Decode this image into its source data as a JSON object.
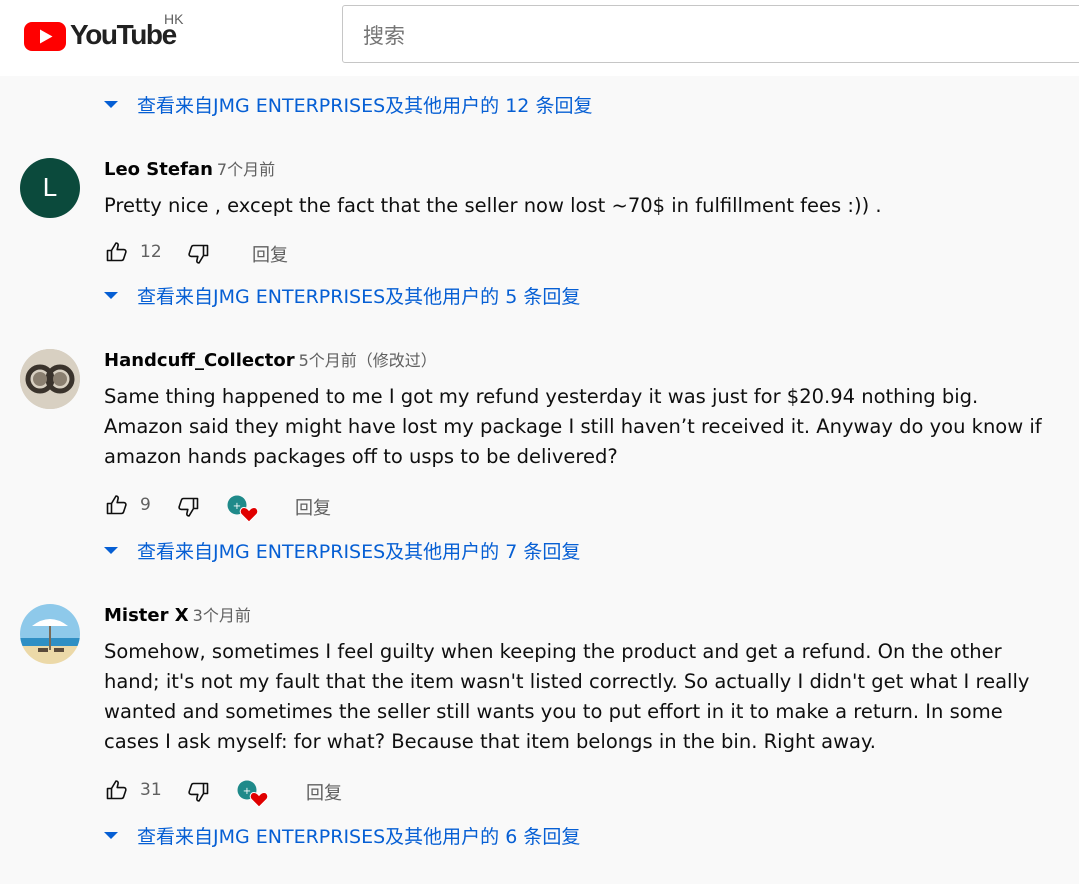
{
  "header": {
    "logo_text": "YouTube",
    "region": "HK",
    "search_placeholder": "搜索"
  },
  "colors": {
    "link": "#065fd4",
    "brand_red": "#ff0000",
    "heart": "#e00000"
  },
  "replies_toggles": [
    {
      "prefix": "查看来自JMG ENTERPRISES及其他用户的 ",
      "count": "12",
      "suffix": " 条回复"
    },
    {
      "prefix": "查看来自JMG ENTERPRISES及其他用户的 ",
      "count": "5",
      "suffix": " 条回复"
    },
    {
      "prefix": "查看来自JMG ENTERPRISES及其他用户的 ",
      "count": "7",
      "suffix": " 条回复"
    },
    {
      "prefix": "查看来自JMG ENTERPRISES及其他用户的 ",
      "count": "6",
      "suffix": " 条回复"
    }
  ],
  "comments": [
    {
      "author": "Leo Stefan",
      "time": "7个月前",
      "avatar_letter": "L",
      "lines": [
        "Pretty nice , except the fact that the seller now lost ~70$ in fulfillment fees :)) ."
      ],
      "likes": "12",
      "reply_label": "回复"
    },
    {
      "author": "Handcuff_Collector",
      "time": "5个月前（修改过）",
      "lines": [
        "Same thing happened to me I got my refund yesterday it was just for $20.94 nothing big.",
        "Amazon said they might have lost my package I still haven’t received it. Anyway do you know if",
        "amazon hands packages off to usps to be delivered?"
      ],
      "likes": "9",
      "reply_label": "回复"
    },
    {
      "author": "Mister X",
      "time": "3个月前",
      "lines": [
        "Somehow, sometimes I feel guilty when keeping the product and get a refund. On the other",
        "hand; it's not my fault that the item wasn't listed correctly. So actually I didn't get what I really",
        "wanted and sometimes the seller still wants you to put effort in it to make a return. In some",
        "cases I ask myself: for what? Because that item belongs in the bin. Right away."
      ],
      "likes": "31",
      "reply_label": "回复"
    }
  ]
}
